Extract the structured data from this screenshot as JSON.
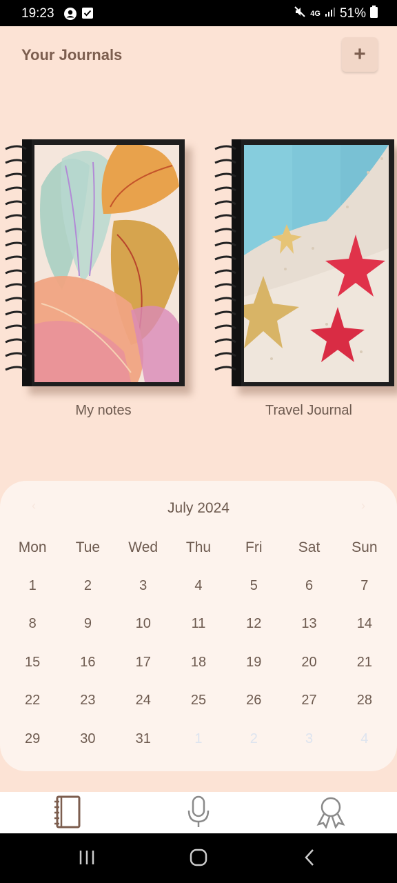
{
  "status": {
    "time": "19:23",
    "network": "4G",
    "battery": "51%"
  },
  "header": {
    "title": "Your Journals",
    "add_label": "+"
  },
  "journals": [
    {
      "title": "My notes"
    },
    {
      "title": "Travel Journal"
    }
  ],
  "calendar": {
    "month": "July 2024",
    "weekdays": [
      "Mon",
      "Tue",
      "Wed",
      "Thu",
      "Fri",
      "Sat",
      "Sun"
    ],
    "weeks": [
      [
        "1",
        "2",
        "3",
        "4",
        "5",
        "6",
        "7"
      ],
      [
        "8",
        "9",
        "10",
        "11",
        "12",
        "13",
        "14"
      ],
      [
        "15",
        "16",
        "17",
        "18",
        "19",
        "20",
        "21"
      ],
      [
        "22",
        "23",
        "24",
        "25",
        "26",
        "27",
        "28"
      ],
      [
        "29",
        "30",
        "31",
        "1",
        "2",
        "3",
        "4"
      ]
    ]
  },
  "colors": {
    "background": "#fce3d5",
    "accent": "#7c5e4f",
    "calendar_bg": "#fdf3ed",
    "muted_day": "#dde4ef"
  },
  "nav": {
    "items": [
      "journal-icon",
      "microphone-icon",
      "award-icon"
    ]
  }
}
